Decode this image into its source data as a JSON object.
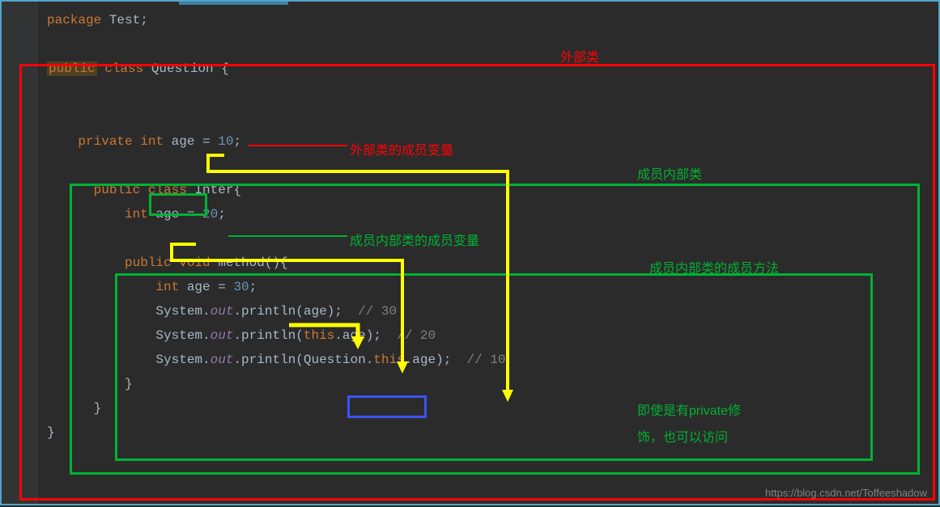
{
  "code": {
    "l1_package": "package",
    "l1_pkgname": " Test",
    "l2_public": "public",
    "l2_class": " class ",
    "l2_name": "Question {",
    "l3_private": "private",
    "l3_int": " int ",
    "l3_var": "age",
    "l3_eq": " = ",
    "l3_val": "10",
    "l4_public": "public",
    "l4_class": " class ",
    "l4_name": "Inter{",
    "l5_int": "int ",
    "l5_var": "age",
    "l5_eq": " = ",
    "l5_val": "20",
    "l6_public": "public",
    "l6_void": " void ",
    "l6_name": "method(){",
    "l7_int": "int ",
    "l7_var": "age",
    "l7_eq": " = ",
    "l7_val": "30",
    "l8_sys": "System.",
    "l8_out": "out",
    "l8_print": ".println(age)",
    "l8_semi": "; ",
    "l8_comment": " // 30",
    "l9_sys": "System.",
    "l9_out": "out",
    "l9_print": ".println(",
    "l9_this": "this",
    "l9_age": ".age)",
    "l9_semi": "; ",
    "l9_comment": " // 20",
    "l10_sys": "System.",
    "l10_out": "out",
    "l10_print": ".println(",
    "l10_q": "Question.",
    "l10_this": "this",
    "l10_age": ".age)",
    "l10_semi": "; ",
    "l10_comment": " // 10",
    "brace_close": "}"
  },
  "labels": {
    "outer_class": "外部类",
    "outer_member_var": "外部类的成员变量",
    "inner_class": "成员内部类",
    "inner_member_var": "成员内部类的成员变量",
    "inner_method": "成员内部类的成员方法",
    "private_note1": "即使是有private修",
    "private_note2": "饰，也可以访问"
  },
  "watermark": "https://blog.csdn.net/Toffeeshadow",
  "colors": {
    "red": "#ff0206",
    "green": "#00b233",
    "blue": "#3c52ff",
    "yellow": "#ffff00"
  }
}
